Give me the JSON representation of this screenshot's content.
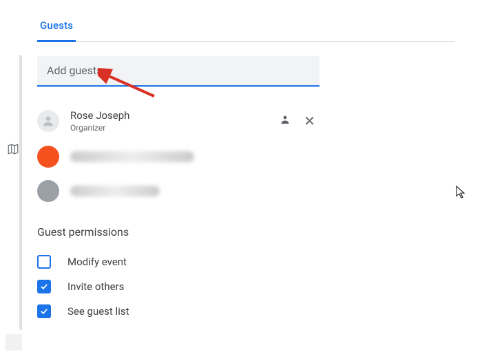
{
  "tab": {
    "label": "Guests"
  },
  "input": {
    "placeholder": "Add guests",
    "value": ""
  },
  "organizer": {
    "name": "Rose Joseph",
    "role": "Organizer"
  },
  "guests_redacted": [
    {},
    {}
  ],
  "permissions": {
    "title": "Guest permissions",
    "items": [
      {
        "label": "Modify event",
        "checked": false
      },
      {
        "label": "Invite others",
        "checked": true
      },
      {
        "label": "See guest list",
        "checked": true
      }
    ]
  }
}
